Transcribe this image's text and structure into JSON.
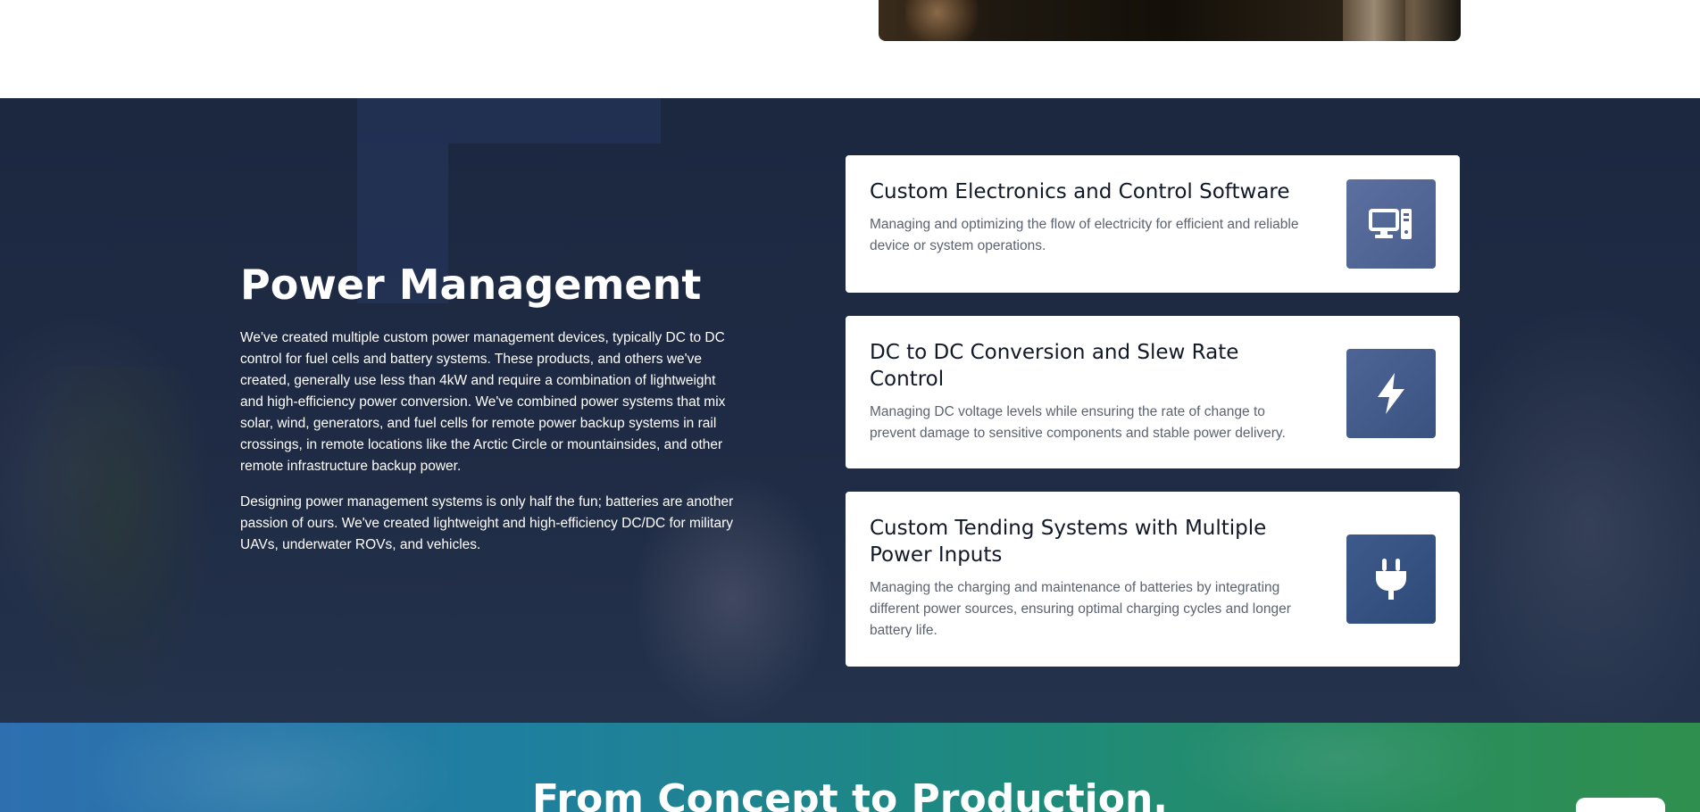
{
  "power_management": {
    "title": "Power Management",
    "paragraphs": [
      "We've created multiple custom power management devices, typically DC to DC control for fuel cells and battery systems. These products, and others we've created, generally use less than 4kW and require a combination of lightweight and high-efficiency power conversion. We've combined power systems that mix solar, wind, generators, and fuel cells for remote power backup systems in rail crossings, in remote locations like the Arctic Circle or mountainsides, and other remote infrastructure backup power.",
      "Designing power management systems is only half the fun; batteries are another passion of ours. We've created lightweight and high-efficiency DC/DC for military UAVs, underwater ROVs, and vehicles."
    ],
    "cards": [
      {
        "title": "Custom Electronics and Control Software",
        "description": "Managing and optimizing the flow of electricity for efficient and reliable device or system operations.",
        "icon": "computer-icon"
      },
      {
        "title": "DC to DC Conversion and Slew Rate Control",
        "description": "Managing DC voltage levels while ensuring the rate of change to prevent damage to sensitive components and stable power delivery.",
        "icon": "lightning-bolt-icon"
      },
      {
        "title": "Custom Tending Systems with Multiple Power Inputs",
        "description": "Managing the charging and maintenance of batteries by integrating different power sources, ensuring optimal charging cycles and longer battery life.",
        "icon": "power-plug-icon"
      }
    ]
  },
  "next_section": {
    "title": "From Concept to Production."
  },
  "colors": {
    "section_bg": "#1e2a42",
    "card_bg": "#ffffff",
    "icon_tile": "#4f6494",
    "gradient_start": "#2e6fb0",
    "gradient_end": "#2f8f4e"
  }
}
